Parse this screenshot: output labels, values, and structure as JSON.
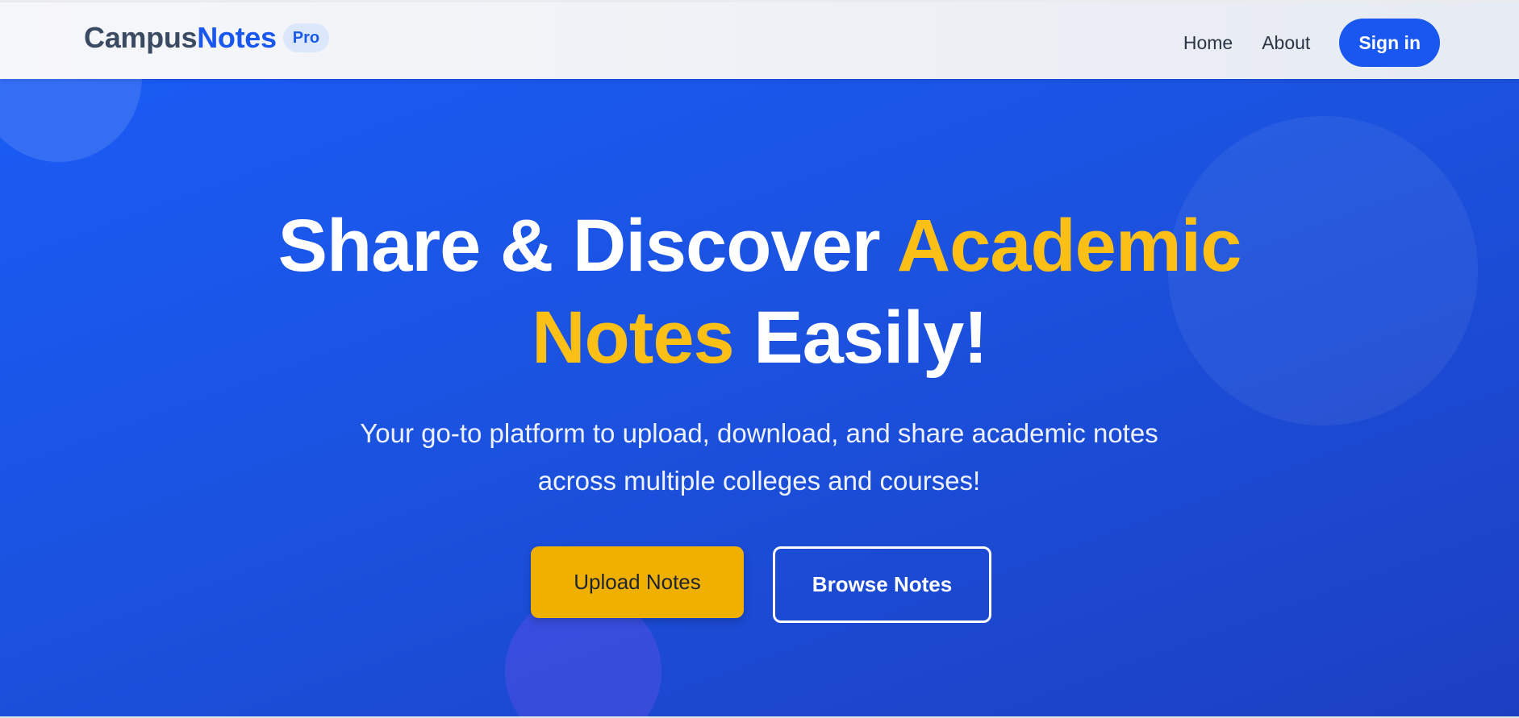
{
  "header": {
    "brand_part1": "Campus",
    "brand_part2": "Notes",
    "badge": "Pro",
    "nav": {
      "home": "Home",
      "about": "About",
      "signin": "Sign in"
    }
  },
  "hero": {
    "headline_part1": "Share & Discover ",
    "headline_highlight1": "Academic",
    "headline_highlight2": "Notes",
    "headline_part2": " Easily!",
    "subtitle": "Your go-to platform to upload, download, and share academic notes across multiple colleges and courses!",
    "upload_button": "Upload Notes",
    "browse_button": "Browse Notes"
  },
  "colors": {
    "brand_blue": "#1957f0",
    "hero_blue": "#1b52df",
    "accent_yellow": "#fbbf16",
    "button_yellow": "#f0b000",
    "text_dark": "#2b3445"
  }
}
